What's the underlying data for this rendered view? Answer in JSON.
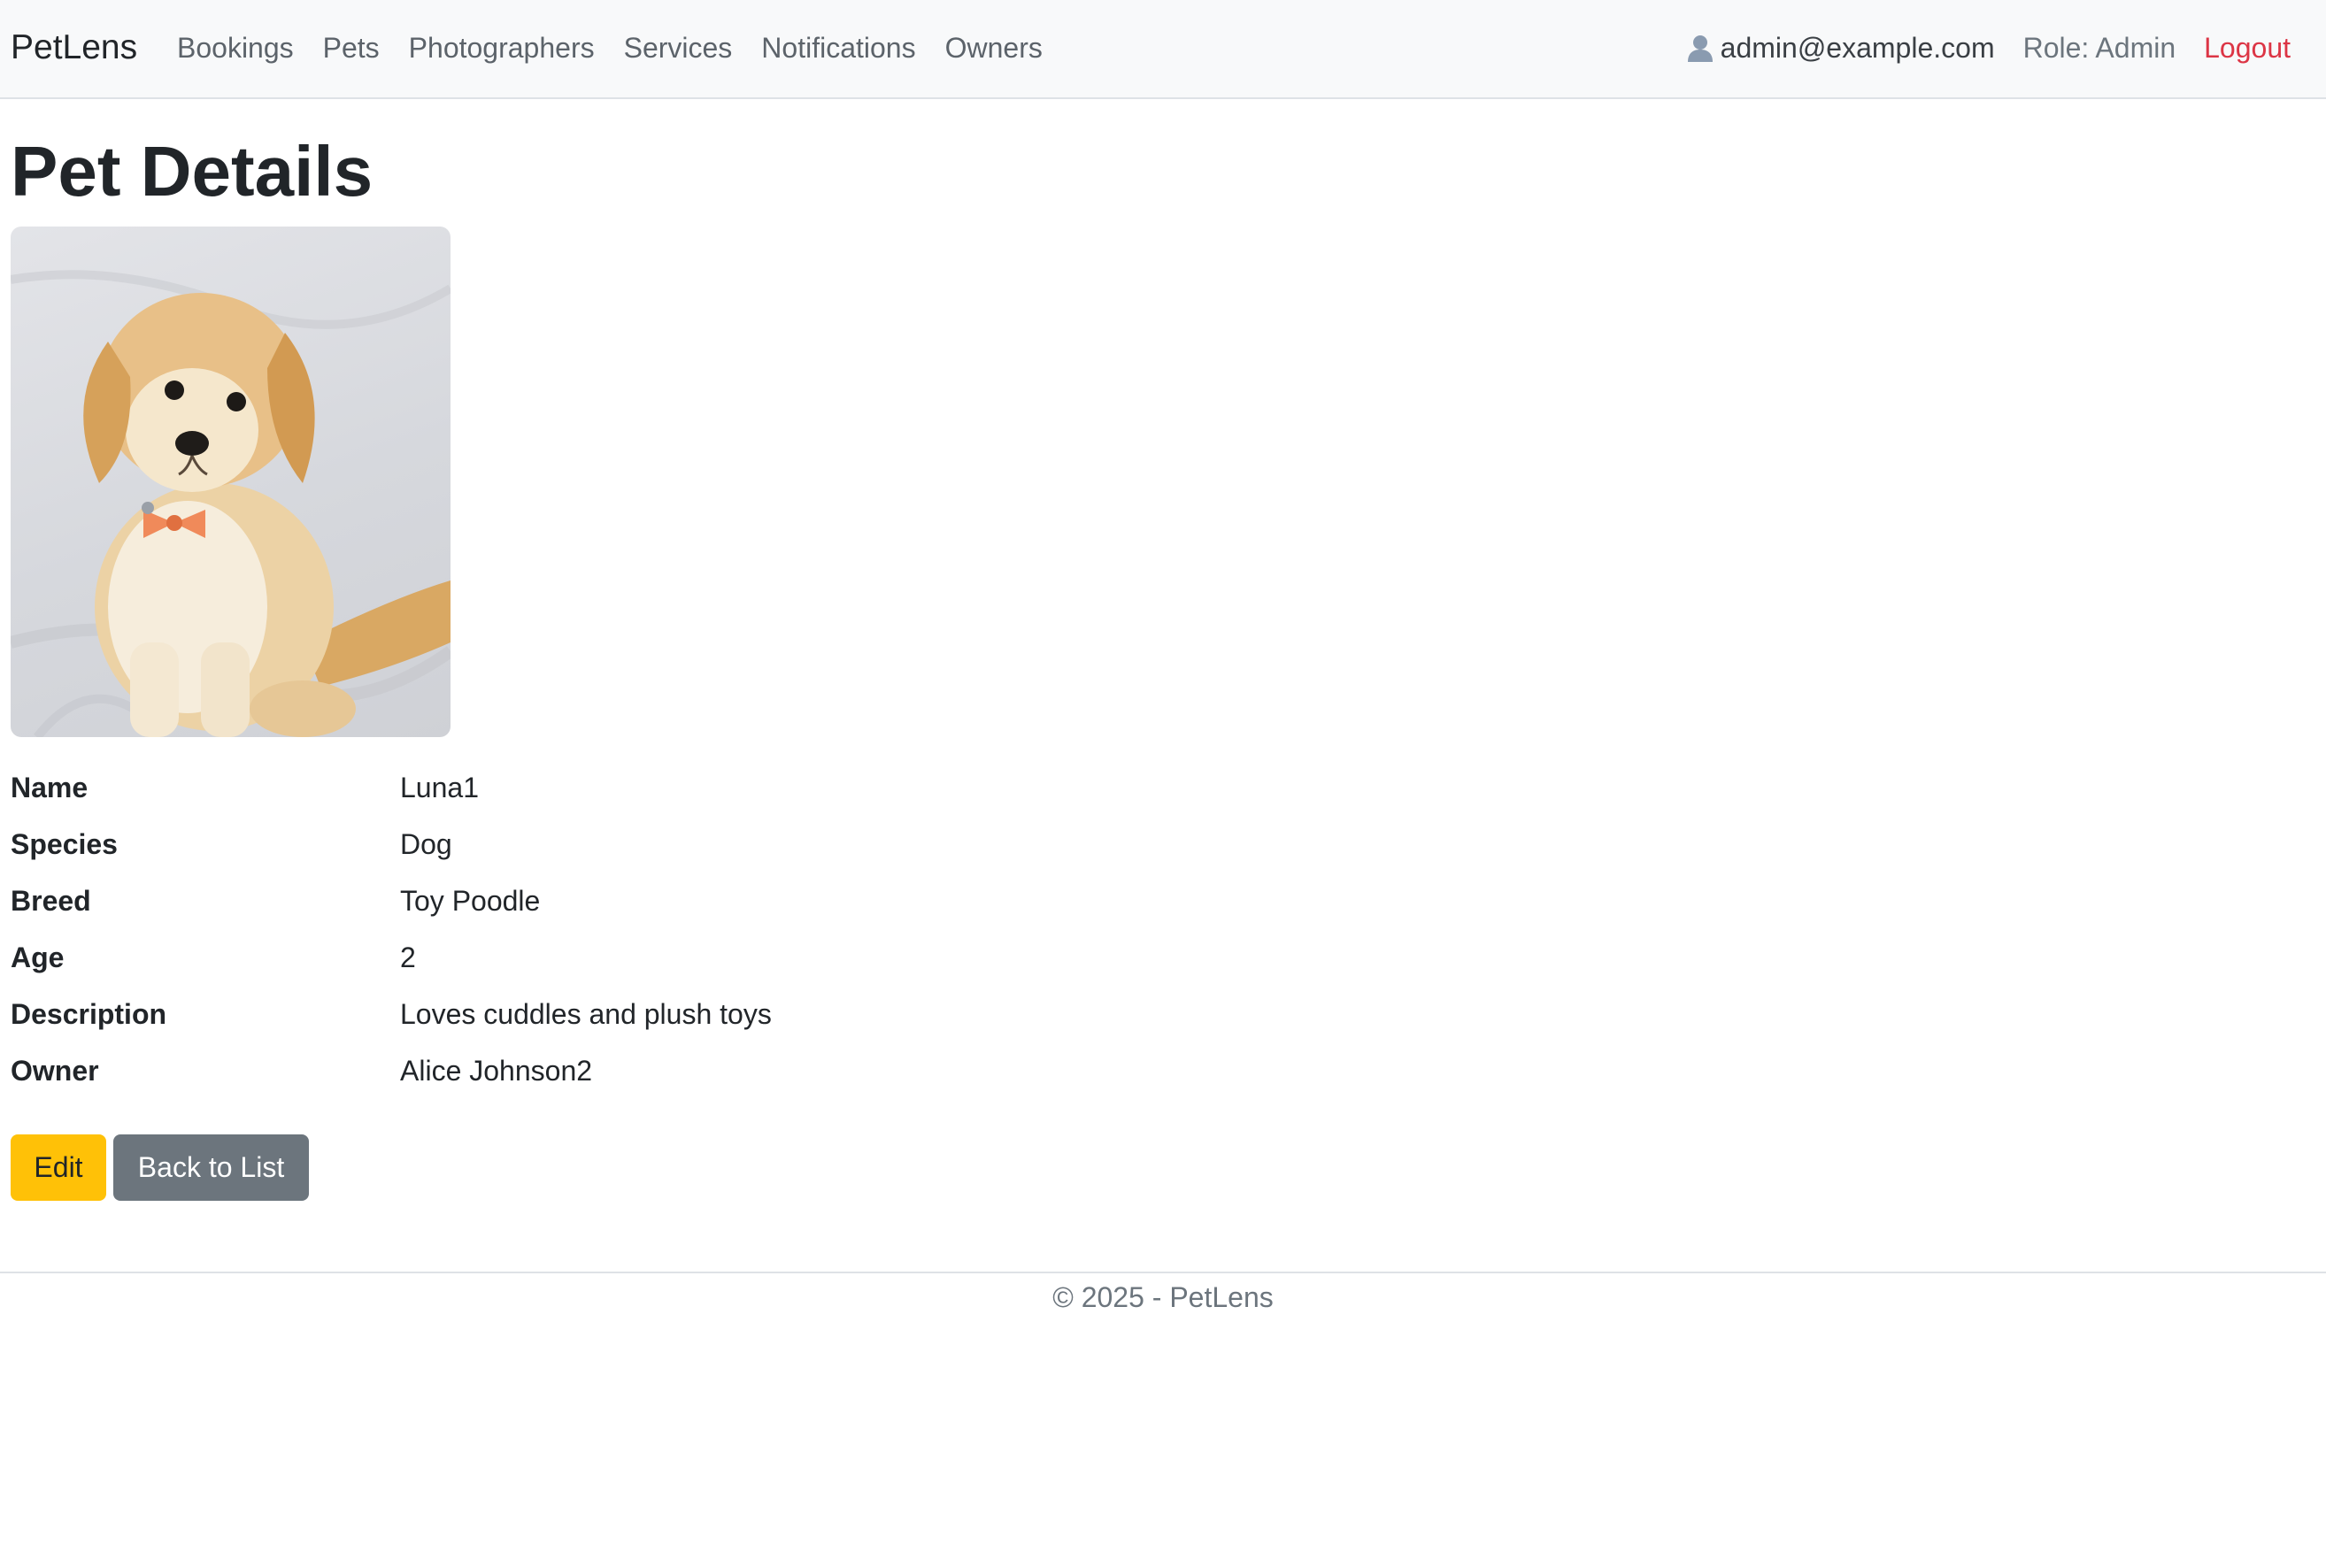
{
  "navbar": {
    "brand": "PetLens",
    "links": [
      "Bookings",
      "Pets",
      "Photographers",
      "Services",
      "Notifications",
      "Owners"
    ],
    "user_icon": "user-icon",
    "user_email": "admin@example.com",
    "role": "Role: Admin",
    "logout": "Logout"
  },
  "page": {
    "title": "Pet Details"
  },
  "pet": {
    "fields": [
      {
        "label": "Name",
        "value": "Luna1"
      },
      {
        "label": "Species",
        "value": "Dog"
      },
      {
        "label": "Breed",
        "value": "Toy Poodle"
      },
      {
        "label": "Age",
        "value": "2"
      },
      {
        "label": "Description",
        "value": "Loves cuddles and plush toys"
      },
      {
        "label": "Owner",
        "value": "Alice Johnson2"
      }
    ]
  },
  "actions": {
    "edit": "Edit",
    "back": "Back to List"
  },
  "footer": {
    "text": "© 2025 - PetLens"
  },
  "colors": {
    "navbar_bg": "#f8f9fa",
    "logout": "#dc3545",
    "edit_button": "#ffc107",
    "back_button": "#6c757d"
  }
}
